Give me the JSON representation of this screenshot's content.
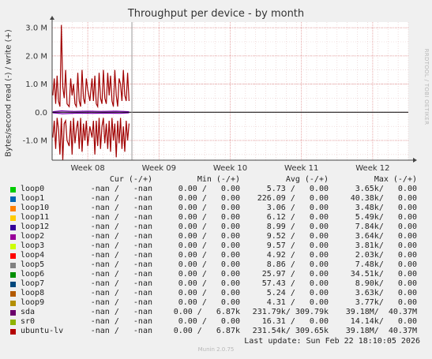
{
  "chart_data": {
    "type": "line",
    "title": "Throughput per device - by month",
    "ylabel": "Bytes/second read (-) / write (+)",
    "ylim": [
      -1.7,
      3.2
    ],
    "ytick_values": [
      3.0,
      2.0,
      1.0,
      0.0,
      -1.0
    ],
    "ytick_labels": [
      "3.0 M",
      "2.0 M",
      "1.0 M",
      "0.0",
      "-1.0 M"
    ],
    "xlim": [
      0,
      5
    ],
    "xtick_values": [
      0.5,
      1.5,
      2.5,
      3.5,
      4.5
    ],
    "xtick_labels": [
      "Week 08",
      "Week 09",
      "Week 10",
      "Week 11",
      "Week 12"
    ],
    "now_marker": 1.12,
    "grid": true,
    "series": [
      {
        "name": "ubuntu-lv",
        "color": "#a00000",
        "write": [
          [
            0.01,
            0.6
          ],
          [
            0.03,
            1.2
          ],
          [
            0.05,
            0.3
          ],
          [
            0.07,
            1.3
          ],
          [
            0.09,
            0.4
          ],
          [
            0.11,
            0.2
          ],
          [
            0.13,
            3.1
          ],
          [
            0.15,
            0.9
          ],
          [
            0.17,
            0.5
          ],
          [
            0.19,
            1.5
          ],
          [
            0.21,
            0.3
          ],
          [
            0.24,
            0.2
          ],
          [
            0.26,
            1.2
          ],
          [
            0.28,
            0.6
          ],
          [
            0.3,
            1.0
          ],
          [
            0.32,
            0.3
          ],
          [
            0.34,
            0.2
          ],
          [
            0.36,
            1.4
          ],
          [
            0.38,
            0.4
          ],
          [
            0.4,
            0.2
          ],
          [
            0.42,
            1.5
          ],
          [
            0.44,
            0.5
          ],
          [
            0.46,
            0.3
          ],
          [
            0.48,
            1.2
          ],
          [
            0.5,
            0.8
          ],
          [
            0.53,
            0.4
          ],
          [
            0.56,
            1.2
          ],
          [
            0.58,
            0.4
          ],
          [
            0.6,
            1.3
          ],
          [
            0.62,
            0.3
          ],
          [
            0.64,
            0.2
          ],
          [
            0.66,
            1.4
          ],
          [
            0.68,
            0.5
          ],
          [
            0.7,
            0.3
          ],
          [
            0.72,
            1.5
          ],
          [
            0.74,
            0.5
          ],
          [
            0.76,
            0.3
          ],
          [
            0.78,
            1.4
          ],
          [
            0.8,
            0.6
          ],
          [
            0.82,
            1.3
          ],
          [
            0.84,
            0.4
          ],
          [
            0.86,
            0.2
          ],
          [
            0.88,
            1.5
          ],
          [
            0.9,
            0.6
          ],
          [
            0.92,
            0.2
          ],
          [
            0.94,
            1.2
          ],
          [
            0.96,
            1.0
          ],
          [
            0.98,
            0.4
          ],
          [
            1.0,
            1.5
          ],
          [
            1.02,
            0.6
          ],
          [
            1.04,
            0.4
          ],
          [
            1.06,
            1.4
          ],
          [
            1.08,
            0.4
          ]
        ],
        "read": [
          [
            0.01,
            -0.9
          ],
          [
            0.03,
            -0.3
          ],
          [
            0.05,
            -1.3
          ],
          [
            0.07,
            -0.2
          ],
          [
            0.09,
            -0.6
          ],
          [
            0.11,
            -1.5
          ],
          [
            0.13,
            -0.2
          ],
          [
            0.15,
            -1.7
          ],
          [
            0.17,
            -0.4
          ],
          [
            0.19,
            -0.3
          ],
          [
            0.21,
            -1.0
          ],
          [
            0.24,
            -1.2
          ],
          [
            0.26,
            -0.3
          ],
          [
            0.28,
            -1.5
          ],
          [
            0.3,
            -0.2
          ],
          [
            0.32,
            -1.1
          ],
          [
            0.34,
            -0.6
          ],
          [
            0.36,
            -0.3
          ],
          [
            0.38,
            -1.3
          ],
          [
            0.4,
            -0.2
          ],
          [
            0.42,
            -1.4
          ],
          [
            0.44,
            -0.4
          ],
          [
            0.46,
            -1.0
          ],
          [
            0.48,
            -0.3
          ],
          [
            0.5,
            -1.2
          ],
          [
            0.53,
            -0.5
          ],
          [
            0.56,
            -0.9
          ],
          [
            0.58,
            -0.3
          ],
          [
            0.6,
            -1.5
          ],
          [
            0.62,
            -0.3
          ],
          [
            0.64,
            -1.2
          ],
          [
            0.66,
            -0.2
          ],
          [
            0.68,
            -1.3
          ],
          [
            0.7,
            -0.5
          ],
          [
            0.72,
            -0.2
          ],
          [
            0.74,
            -1.1
          ],
          [
            0.76,
            -0.4
          ],
          [
            0.78,
            -1.3
          ],
          [
            0.8,
            -0.3
          ],
          [
            0.82,
            -1.4
          ],
          [
            0.84,
            -0.2
          ],
          [
            0.86,
            -1.0
          ],
          [
            0.88,
            -0.4
          ],
          [
            0.9,
            -1.6
          ],
          [
            0.92,
            -0.3
          ],
          [
            0.94,
            -1.1
          ],
          [
            0.96,
            -0.2
          ],
          [
            0.98,
            -1.3
          ],
          [
            1.0,
            -0.5
          ],
          [
            1.02,
            -1.4
          ],
          [
            1.04,
            -0.3
          ],
          [
            1.06,
            -1.0
          ],
          [
            1.08,
            -0.4
          ]
        ]
      },
      {
        "name": "sda",
        "color": "#7b00b4",
        "write": [
          [
            0.01,
            0.02
          ],
          [
            0.13,
            0.05
          ],
          [
            0.3,
            0.03
          ],
          [
            0.5,
            0.04
          ],
          [
            0.7,
            0.03
          ],
          [
            0.9,
            0.04
          ],
          [
            1.08,
            0.02
          ]
        ],
        "read": [
          [
            0.01,
            -0.02
          ],
          [
            0.15,
            -0.05
          ],
          [
            0.35,
            -0.03
          ],
          [
            0.55,
            -0.04
          ],
          [
            0.75,
            -0.03
          ],
          [
            0.95,
            -0.04
          ],
          [
            1.08,
            -0.02
          ]
        ]
      }
    ]
  },
  "legend": {
    "headers": {
      "cur": "Cur (-/+)",
      "min": "Min (-/+)",
      "avg": "Avg (-/+)",
      "max": "Max (-/+)"
    },
    "rows": [
      {
        "name": "loop0",
        "color": "#00cc00",
        "cur": "-nan /   -nan",
        "min": "0.00 /   0.00",
        "avg": "5.73 /   0.00",
        "max": "3.65k/   0.00"
      },
      {
        "name": "loop1",
        "color": "#0066b3",
        "cur": "-nan /   -nan",
        "min": "0.00 /   0.00",
        "avg": "226.09 /   0.00",
        "max": "40.38k/   0.00"
      },
      {
        "name": "loop10",
        "color": "#ff8000",
        "cur": "-nan /   -nan",
        "min": "0.00 /   0.00",
        "avg": "3.06 /   0.00",
        "max": "3.48k/   0.00"
      },
      {
        "name": "loop11",
        "color": "#ffcc00",
        "cur": "-nan /   -nan",
        "min": "0.00 /   0.00",
        "avg": "6.12 /   0.00",
        "max": "5.49k/   0.00"
      },
      {
        "name": "loop12",
        "color": "#330099",
        "cur": "-nan /   -nan",
        "min": "0.00 /   0.00",
        "avg": "8.99 /   0.00",
        "max": "7.84k/   0.00"
      },
      {
        "name": "loop2",
        "color": "#990099",
        "cur": "-nan /   -nan",
        "min": "0.00 /   0.00",
        "avg": "9.52 /   0.00",
        "max": "3.64k/   0.00"
      },
      {
        "name": "loop3",
        "color": "#ccff00",
        "cur": "-nan /   -nan",
        "min": "0.00 /   0.00",
        "avg": "9.57 /   0.00",
        "max": "3.81k/   0.00"
      },
      {
        "name": "loop4",
        "color": "#ff0000",
        "cur": "-nan /   -nan",
        "min": "0.00 /   0.00",
        "avg": "4.92 /   0.00",
        "max": "2.03k/   0.00"
      },
      {
        "name": "loop5",
        "color": "#808080",
        "cur": "-nan /   -nan",
        "min": "0.00 /   0.00",
        "avg": "8.86 /   0.00",
        "max": "7.48k/   0.00"
      },
      {
        "name": "loop6",
        "color": "#008f00",
        "cur": "-nan /   -nan",
        "min": "0.00 /   0.00",
        "avg": "25.97 /   0.00",
        "max": "34.51k/   0.00"
      },
      {
        "name": "loop7",
        "color": "#00487d",
        "cur": "-nan /   -nan",
        "min": "0.00 /   0.00",
        "avg": "57.43 /   0.00",
        "max": "8.90k/   0.00"
      },
      {
        "name": "loop8",
        "color": "#b35a00",
        "cur": "-nan /   -nan",
        "min": "0.00 /   0.00",
        "avg": "5.24 /   0.00",
        "max": "3.63k/   0.00"
      },
      {
        "name": "loop9",
        "color": "#b38f00",
        "cur": "-nan /   -nan",
        "min": "0.00 /   0.00",
        "avg": "4.31 /   0.00",
        "max": "3.77k/   0.00"
      },
      {
        "name": "sda",
        "color": "#6b006b",
        "cur": "-nan /   -nan",
        "min": "0.00 /   6.87k",
        "avg": "231.79k/ 309.79k",
        "max": "39.18M/  40.37M"
      },
      {
        "name": "sr0",
        "color": "#8fb300",
        "cur": "-nan /   -nan",
        "min": "0.00 /   0.00",
        "avg": "16.31 /   0.00",
        "max": "14.14k/   0.00"
      },
      {
        "name": "ubuntu-lv",
        "color": "#b30000",
        "cur": "-nan /   -nan",
        "min": "0.00 /   6.87k",
        "avg": "231.54k/ 309.65k",
        "max": "39.18M/  40.37M"
      }
    ]
  },
  "last_update": "Last update: Sun Feb 22 18:10:05 2026",
  "watermark": "RRDTOOL / TOBI OETIKER",
  "footer": "Munin 2.0.75"
}
